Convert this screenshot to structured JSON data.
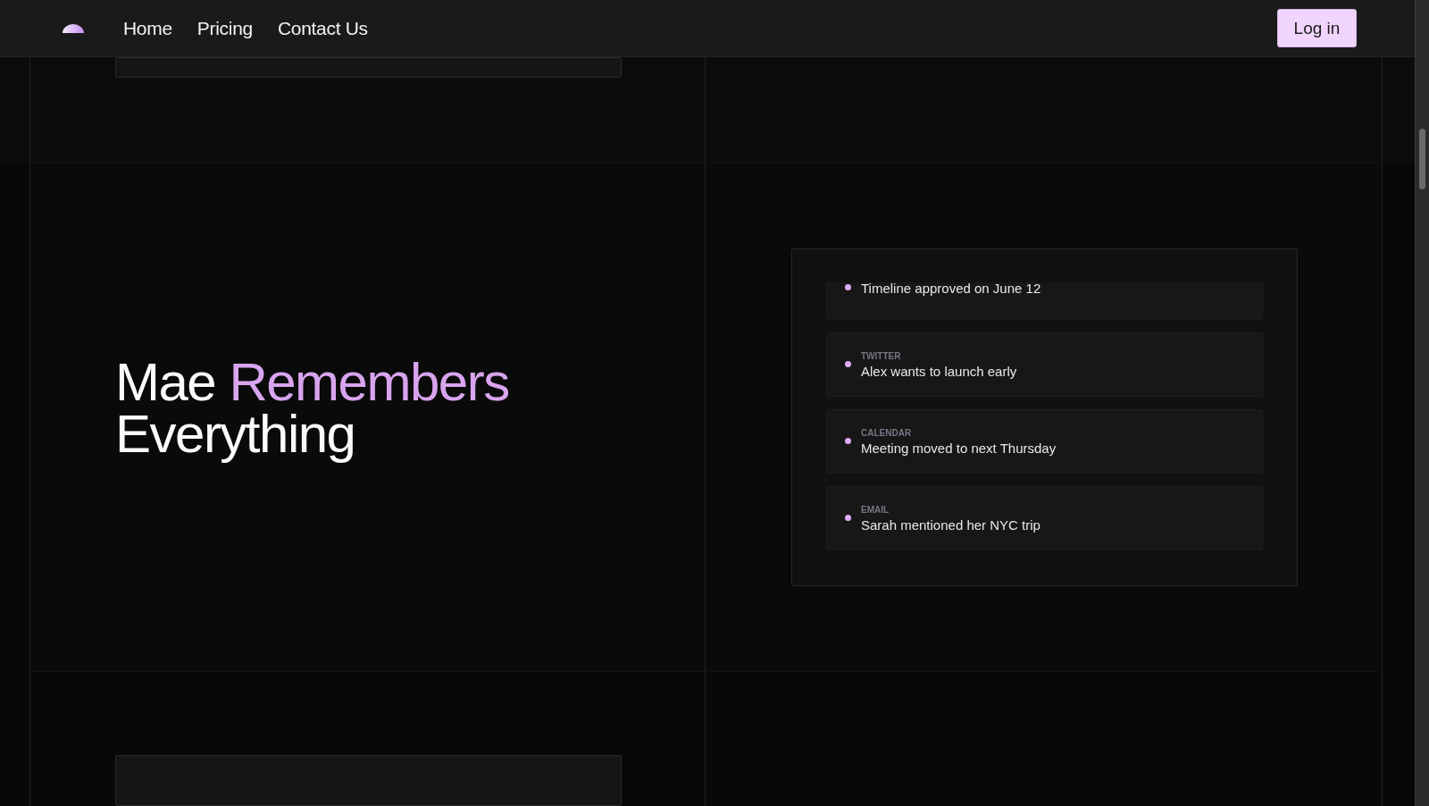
{
  "nav": {
    "links": [
      "Home",
      "Pricing",
      "Contact Us"
    ],
    "login_button": "Log in"
  },
  "hero": {
    "heading": [
      {
        "text": "Mae",
        "highlight": false
      },
      {
        "text": "Remembers",
        "highlight": true
      },
      {
        "text": "Everything",
        "highlight": false
      }
    ]
  },
  "memory_card": {
    "items": [
      {
        "text": "Timeline approved on June 12"
      },
      {
        "source": "TWITTER",
        "text": "Alex wants to launch early"
      },
      {
        "source": "CALENDAR",
        "text": "Meeting moved to next Thursday"
      },
      {
        "source": "EMAIL",
        "text": "Sarah mentioned her NYC trip"
      }
    ]
  }
}
